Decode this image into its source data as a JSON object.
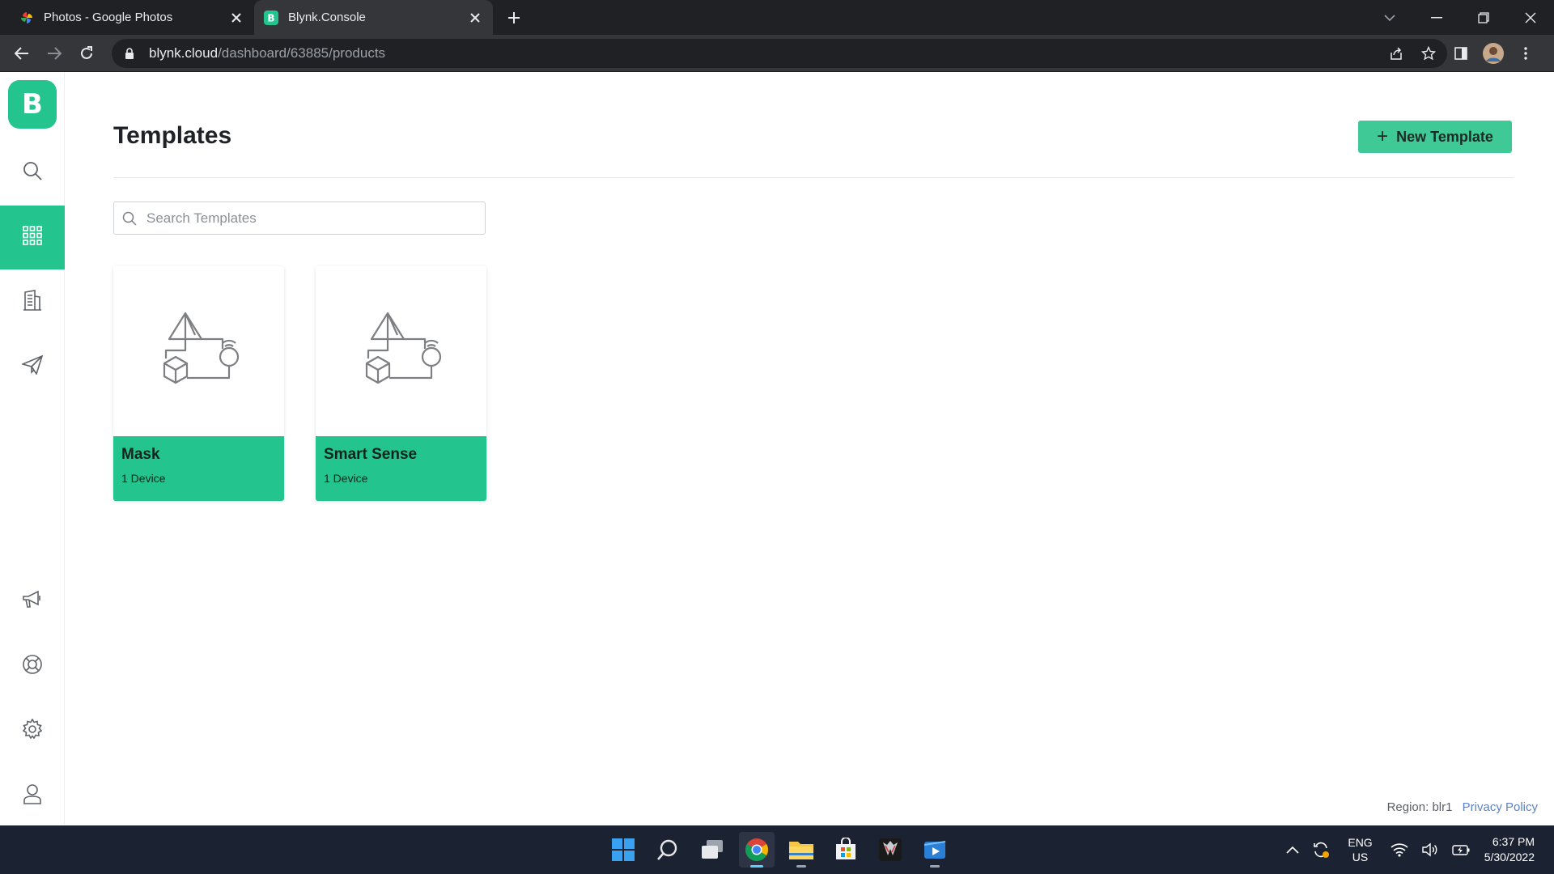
{
  "browser": {
    "tabs": [
      {
        "title": "Photos - Google Photos",
        "active": false
      },
      {
        "title": "Blynk.Console",
        "active": true
      }
    ],
    "url_host": "blynk.cloud",
    "url_path": "/dashboard/63885/products"
  },
  "app": {
    "logo_letter": "B",
    "page_title": "Templates",
    "new_template_label": "New Template",
    "search_placeholder": "Search Templates",
    "sidebar_active": "templates",
    "templates": [
      {
        "name": "Mask",
        "count": "1 Device"
      },
      {
        "name": "Smart Sense",
        "count": "1 Device"
      }
    ],
    "footer_region": "Region: blr1",
    "footer_privacy": "Privacy Policy",
    "accent_color": "#23c48e"
  },
  "taskbar": {
    "lang_top": "ENG",
    "lang_bottom": "US",
    "time": "6:37 PM",
    "date": "5/30/2022"
  }
}
